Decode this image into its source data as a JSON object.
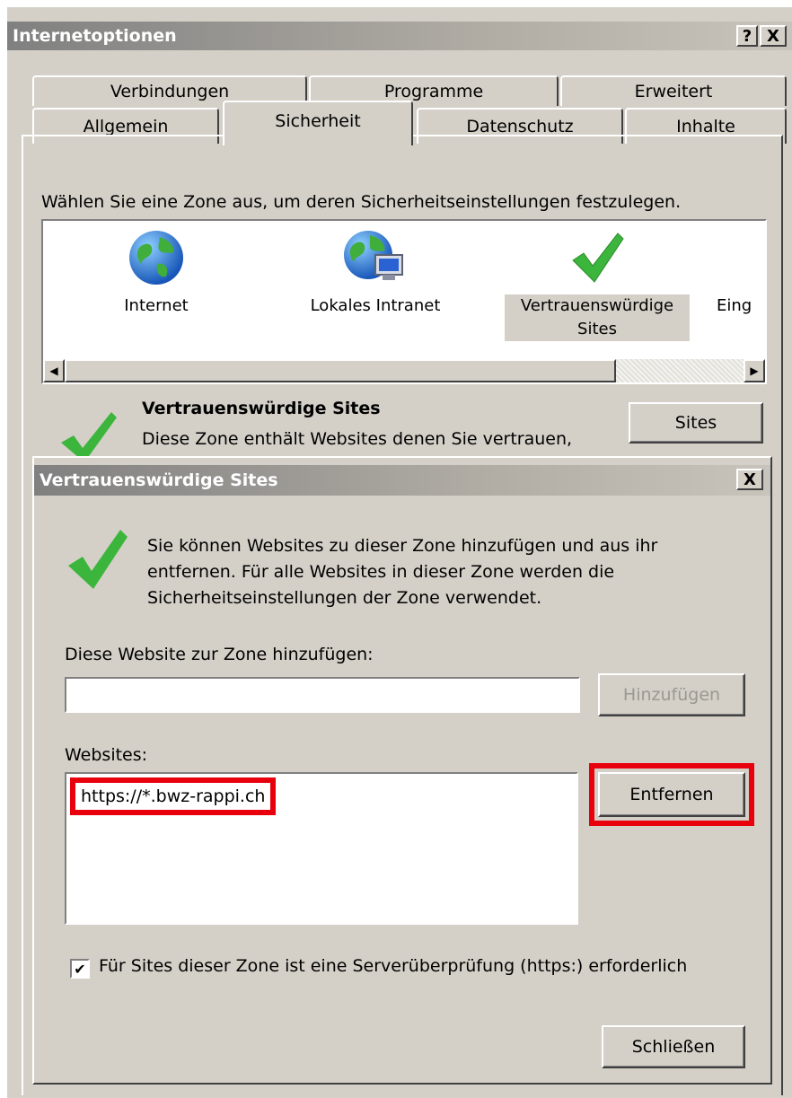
{
  "outer_dialog": {
    "title": "Internetoptionen",
    "help_label": "?",
    "close_label": "X",
    "tabs_row1": [
      "Verbindungen",
      "Programme",
      "Erweitert"
    ],
    "tabs_row2": [
      "Allgemein",
      "Sicherheit",
      "Datenschutz",
      "Inhalte"
    ],
    "active_tab": "Sicherheit",
    "zone_prompt": "Wählen Sie eine Zone aus, um deren Sicherheitseinstellungen festzulegen.",
    "zones": [
      {
        "label": "Internet",
        "icon": "globe-icon"
      },
      {
        "label": "Lokales Intranet",
        "icon": "intranet-icon"
      },
      {
        "label": "Vertrauenswürdige Sites",
        "icon": "checkmark-icon",
        "selected": true
      },
      {
        "label": "Eing",
        "icon": "restricted-icon"
      }
    ],
    "zone_desc_title": "Vertrauenswürdige Sites",
    "zone_desc_text": "Diese Zone enthält Websites denen Sie vertrauen,",
    "sites_button": "Sites"
  },
  "inner_dialog": {
    "title": "Vertrauenswürdige Sites",
    "close_label": "X",
    "intro": "Sie können Websites zu dieser Zone hinzufügen und aus ihr entfernen. Für alle Websites in dieser Zone werden die Sicherheitseinstellungen der Zone verwendet.",
    "add_label": "Diese Website zur Zone hinzufügen:",
    "add_input_value": "",
    "add_button": "Hinzufügen",
    "websites_label": "Websites:",
    "websites": [
      "https://*.bwz-rappi.ch"
    ],
    "remove_button": "Entfernen",
    "https_checkbox_checked": true,
    "https_checkbox_label": "Für Sites dieser Zone ist eine Serverüberprüfung (https:) erforderlich",
    "close_button": "Schließen"
  },
  "colors": {
    "dialog_bg": "#d4d0c8",
    "highlight_red": "#e8000c",
    "check_green": "#3cb53c"
  }
}
